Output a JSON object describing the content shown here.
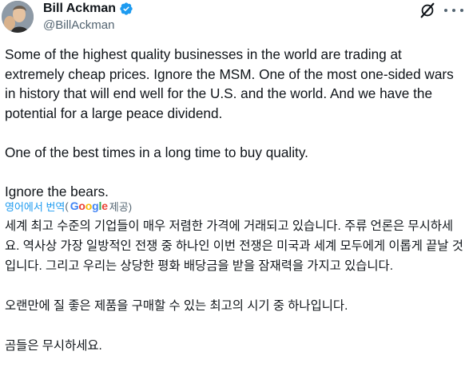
{
  "author": {
    "name": "Bill Ackman",
    "handle": "@BillAckman",
    "verified": true,
    "verified_color": "#1d9bf0"
  },
  "icons": {
    "avatar": "profile-photo",
    "verified": "verified-badge-icon",
    "grok": "grok-icon",
    "more": "more-icon"
  },
  "tweet": {
    "paragraphs": [
      "Some of the highest quality businesses in the world are trading at extremely cheap prices. Ignore the MSM. One of the most one-sided wars in history that will end well for the U.S. and the world. And we have the potential for a large peace dividend.",
      "One of the best times in a long time to buy quality.",
      "Ignore the bears."
    ]
  },
  "translation": {
    "label": "영어에서 번역",
    "open_paren": "(",
    "google": "Google",
    "suffix": " 제공)",
    "link_color": "#1d9bf0",
    "paragraphs": [
      "세계 최고 수준의 기업들이 매우 저렴한 가격에 거래되고 있습니다. 주류 언론은 무시하세요. 역사상 가장 일방적인 전쟁 중 하나인 이번 전쟁은 미국과 세계 모두에게 이롭게 끝날 것입니다. 그리고 우리는 상당한 평화 배당금을 받을 잠재력을 가지고 있습니다.",
      "오랜만에 질 좋은 제품을 구매할 수 있는 최고의 시기 중 하나입니다.",
      "곰들은 무시하세요."
    ]
  }
}
